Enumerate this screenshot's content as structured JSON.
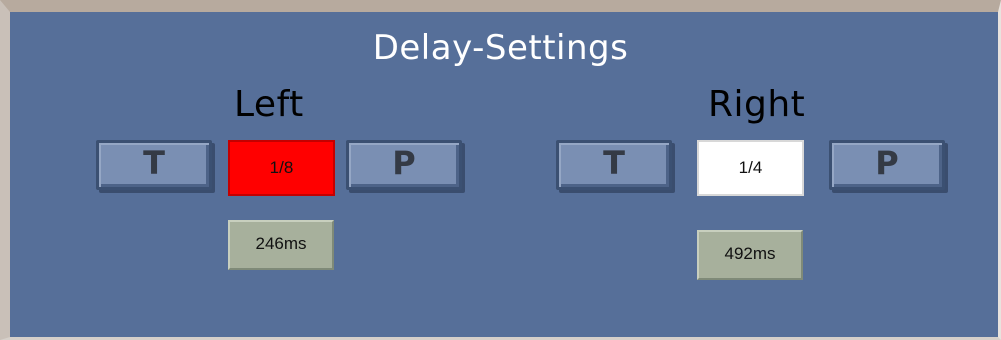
{
  "panel": {
    "title": "Delay-Settings"
  },
  "left": {
    "label": "Left",
    "tap_label": "T",
    "division_value": "1/8",
    "ping_label": "P",
    "time_value": "246ms",
    "division_color": "#ff0000"
  },
  "right": {
    "label": "Right",
    "tap_label": "T",
    "division_value": "1/4",
    "ping_label": "P",
    "time_value": "492ms",
    "division_color": "#ffffff"
  },
  "colors": {
    "panel_background": "#566f99",
    "button_face": "#7a8fb3",
    "time_display": "#a7b09c"
  }
}
